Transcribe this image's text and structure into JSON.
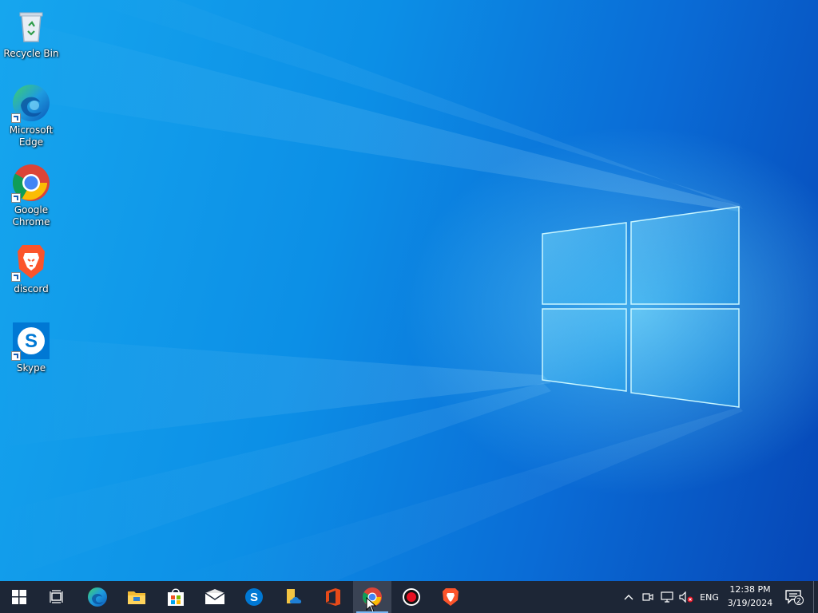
{
  "desktop": {
    "icons": [
      {
        "label": "Recycle Bin",
        "icon": "recycle-bin-icon"
      },
      {
        "label": "Microsoft Edge",
        "icon": "edge-icon"
      },
      {
        "label": "Google Chrome",
        "icon": "chrome-icon"
      },
      {
        "label": "discord",
        "icon": "brave-icon"
      },
      {
        "label": "Skype",
        "icon": "skype-icon"
      }
    ]
  },
  "taskbar": {
    "apps": [
      {
        "name": "start",
        "icon": "windows-logo-icon"
      },
      {
        "name": "task-view",
        "icon": "task-view-icon"
      },
      {
        "name": "edge",
        "icon": "edge-icon"
      },
      {
        "name": "file-explorer",
        "icon": "folder-icon"
      },
      {
        "name": "microsoft-store",
        "icon": "store-icon"
      },
      {
        "name": "mail",
        "icon": "mail-icon"
      },
      {
        "name": "skype",
        "icon": "skype-icon"
      },
      {
        "name": "onedrive-files",
        "icon": "onedrive-icon"
      },
      {
        "name": "office",
        "icon": "office-icon"
      },
      {
        "name": "chrome",
        "icon": "chrome-icon",
        "active": true
      },
      {
        "name": "recorder",
        "icon": "record-icon"
      },
      {
        "name": "brave",
        "icon": "brave-icon"
      }
    ],
    "tray": {
      "language": "ENG",
      "time": "12:38 PM",
      "date": "3/19/2024",
      "notification_count": "2"
    }
  },
  "colors": {
    "taskbar": "#1d2636",
    "wallpaper_accent": "#0a6cd6"
  }
}
